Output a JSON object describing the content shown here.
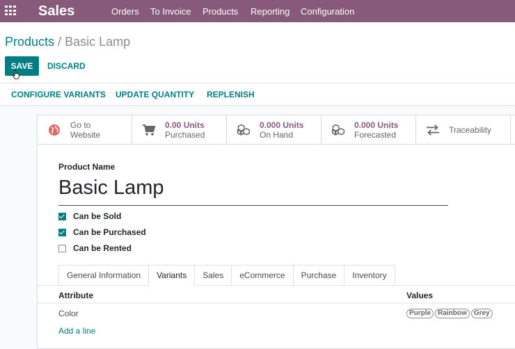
{
  "navbar": {
    "app_name": "Sales",
    "menu": [
      "Orders",
      "To Invoice",
      "Products",
      "Reporting",
      "Configuration"
    ],
    "color": "#875a7b"
  },
  "breadcrumb": {
    "parent": "Products",
    "separator": "/",
    "current": "Basic Lamp"
  },
  "control_panel": {
    "save_label": "SAVE",
    "discard_label": "DISCARD"
  },
  "header_buttons": [
    "CONFIGURE VARIANTS",
    "UPDATE QUANTITY",
    "REPLENISH"
  ],
  "stat_buttons": [
    {
      "value": "Go to",
      "label": "Website",
      "icon": "globe-icon"
    },
    {
      "value": "0.00 Units",
      "label": "Purchased",
      "icon": "cart-icon"
    },
    {
      "value": "0.000 Units",
      "label": "On Hand",
      "icon": "cubes-icon"
    },
    {
      "value": "0.000 Units",
      "label": "Forecasted",
      "icon": "cubes-icon"
    },
    {
      "value": "",
      "label": "Traceability",
      "icon": "exchange-icon"
    }
  ],
  "form": {
    "product_name_label": "Product Name",
    "product_name": "Basic Lamp",
    "checkboxes": [
      {
        "label": "Can be Sold",
        "checked": true
      },
      {
        "label": "Can be Purchased",
        "checked": true
      },
      {
        "label": "Can be Rented",
        "checked": false
      }
    ]
  },
  "tabs": [
    "General Information",
    "Variants",
    "Sales",
    "eCommerce",
    "Purchase",
    "Inventory"
  ],
  "active_tab": "Variants",
  "variants_table": {
    "headers": [
      "Attribute",
      "Values"
    ],
    "rows": [
      {
        "attribute": "Color",
        "values": [
          "Purple",
          "Rainbow",
          "Grey"
        ]
      }
    ],
    "add_line": "Add a line"
  },
  "accent_color": "#017e84"
}
